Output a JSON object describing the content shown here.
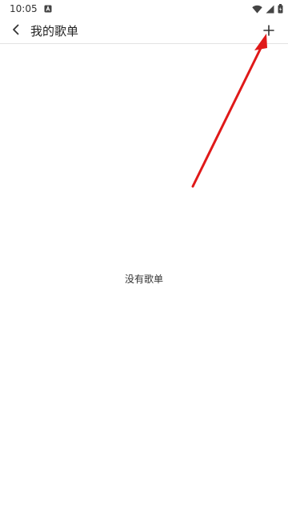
{
  "status_bar": {
    "time": "10:05",
    "notification_icon": "a-notification-icon",
    "wifi_icon": "wifi-icon",
    "signal_icon": "cellular-signal-icon",
    "battery_icon": "battery-icon"
  },
  "app_bar": {
    "back_icon": "chevron-left-icon",
    "title": "我的歌单",
    "add_icon": "plus-icon"
  },
  "main": {
    "empty_message": "没有歌单"
  },
  "annotation": {
    "arrow_color": "#e01919"
  }
}
